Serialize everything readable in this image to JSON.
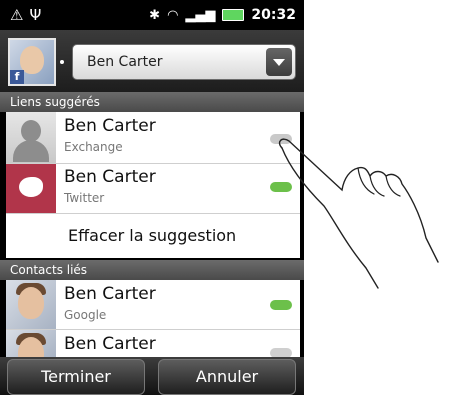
{
  "status_bar": {
    "left_icons": [
      "warning-icon",
      "usb-icon"
    ],
    "right_icons": [
      "bluetooth-icon",
      "wifi-icon",
      "signal-icon",
      "battery-icon"
    ],
    "time": "20:32"
  },
  "header": {
    "contact_name": "Ben Carter"
  },
  "sections": {
    "suggested": "Liens suggérés",
    "linked": "Contacts liés"
  },
  "suggested": [
    {
      "title": "Ben Carter",
      "subtitle": "Exchange",
      "icon": "link-icon"
    },
    {
      "title": "Ben Carter",
      "subtitle": "Twitter",
      "icon": "link-icon"
    }
  ],
  "clear_suggestion": "Effacer la suggestion",
  "linked": [
    {
      "title": "Ben  Carter",
      "subtitle": "Google",
      "icon": "link-icon"
    },
    {
      "title": "Ben Carter",
      "subtitle": "",
      "icon": "link-icon"
    }
  ],
  "buttons": {
    "done": "Terminer",
    "cancel": "Annuler"
  },
  "colors": {
    "link_green": "#6cc04a",
    "twitter_bg": "#b1354a"
  }
}
